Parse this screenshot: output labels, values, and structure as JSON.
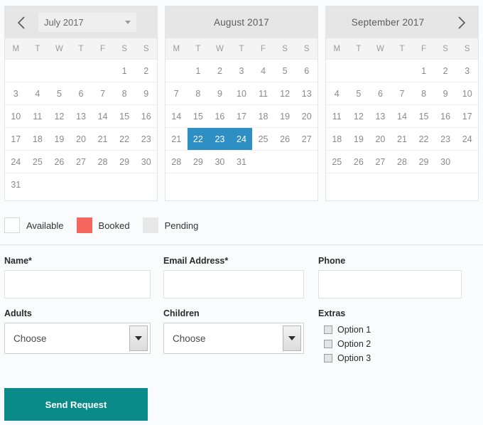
{
  "calendars": [
    {
      "id": "july",
      "title": "July 2017",
      "has_select": true,
      "has_prev_arrow": true,
      "has_next_arrow": false,
      "dow": [
        "M",
        "T",
        "W",
        "T",
        "F",
        "S",
        "S"
      ],
      "weeks": [
        [
          "",
          "",
          "",
          "",
          "",
          "1",
          "2"
        ],
        [
          "3",
          "4",
          "5",
          "6",
          "7",
          "8",
          "9"
        ],
        [
          "10",
          "11",
          "12",
          "13",
          "14",
          "15",
          "16"
        ],
        [
          "17",
          "18",
          "19",
          "20",
          "21",
          "22",
          "23"
        ],
        [
          "24",
          "25",
          "26",
          "27",
          "28",
          "29",
          "30"
        ],
        [
          "31",
          "",
          "",
          "",
          "",
          "",
          ""
        ]
      ],
      "selected": []
    },
    {
      "id": "august",
      "title": "August 2017",
      "has_select": false,
      "has_prev_arrow": false,
      "has_next_arrow": false,
      "dow": [
        "M",
        "T",
        "W",
        "T",
        "F",
        "S",
        "S"
      ],
      "weeks": [
        [
          "",
          "1",
          "2",
          "3",
          "4",
          "5",
          "6"
        ],
        [
          "7",
          "8",
          "9",
          "10",
          "11",
          "12",
          "13"
        ],
        [
          "14",
          "15",
          "16",
          "17",
          "18",
          "19",
          "20"
        ],
        [
          "21",
          "22",
          "23",
          "24",
          "25",
          "26",
          "27"
        ],
        [
          "28",
          "29",
          "30",
          "31",
          "",
          "",
          ""
        ],
        [
          "",
          "",
          "",
          "",
          "",
          "",
          ""
        ]
      ],
      "selected": [
        "22",
        "23",
        "24"
      ]
    },
    {
      "id": "september",
      "title": "September 2017",
      "has_select": false,
      "has_prev_arrow": false,
      "has_next_arrow": true,
      "dow": [
        "M",
        "T",
        "W",
        "T",
        "F",
        "S",
        "S"
      ],
      "weeks": [
        [
          "",
          "",
          "",
          "",
          "1",
          "2",
          "3"
        ],
        [
          "4",
          "5",
          "6",
          "7",
          "8",
          "9",
          "10"
        ],
        [
          "11",
          "12",
          "13",
          "14",
          "15",
          "16",
          "17"
        ],
        [
          "18",
          "19",
          "20",
          "21",
          "22",
          "23",
          "24"
        ],
        [
          "25",
          "26",
          "27",
          "28",
          "29",
          "30",
          ""
        ],
        [
          "",
          "",
          "",
          "",
          "",
          "",
          ""
        ]
      ],
      "selected": []
    }
  ],
  "legend": [
    {
      "label": "Available",
      "color": "#ffffff"
    },
    {
      "label": "Booked",
      "color": "#f4675f"
    },
    {
      "label": "Pending",
      "color": "#e8e8e8"
    }
  ],
  "form": {
    "name": {
      "label": "Name*",
      "value": "",
      "placeholder": ""
    },
    "email": {
      "label": "Email Address*",
      "value": "",
      "placeholder": ""
    },
    "phone": {
      "label": "Phone",
      "value": "",
      "placeholder": ""
    },
    "adults": {
      "label": "Adults",
      "value": "Choose"
    },
    "children": {
      "label": "Children",
      "value": "Choose"
    },
    "extras": {
      "label": "Extras",
      "options": [
        {
          "label": "Option 1",
          "checked": false
        },
        {
          "label": "Option 2",
          "checked": false
        },
        {
          "label": "Option 3",
          "checked": false
        }
      ]
    },
    "submit_label": "Send Request"
  },
  "colors": {
    "selected_day": "#2e8fc4",
    "submit": "#0b8a8a",
    "booked": "#f4675f",
    "header": "#e6e6e6"
  }
}
